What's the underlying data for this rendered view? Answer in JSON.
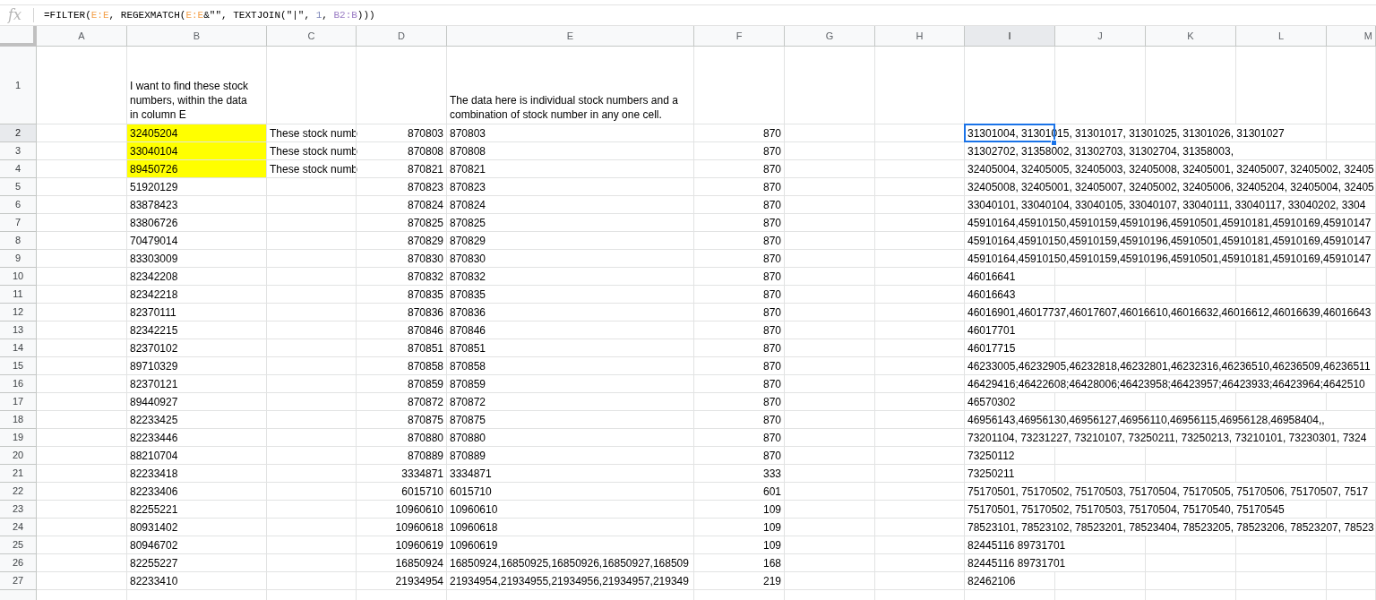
{
  "formula_bar": {
    "function_label": "fx",
    "tokens": [
      {
        "text": "=FILTER(",
        "kind": "plain"
      },
      {
        "text": "E:E",
        "kind": "range",
        "color": "#f4a04a"
      },
      {
        "text": ", REGEXMATCH(",
        "kind": "plain"
      },
      {
        "text": "E:E",
        "kind": "range",
        "color": "#f4a04a"
      },
      {
        "text": "&\"\", TEXTJOIN(\"|\", ",
        "kind": "plain"
      },
      {
        "text": "1",
        "kind": "number"
      },
      {
        "text": ", ",
        "kind": "plain"
      },
      {
        "text": "B2:B",
        "kind": "range",
        "color": "#9a7cc4"
      },
      {
        "text": ")))",
        "kind": "plain"
      }
    ]
  },
  "column_headers": [
    {
      "label": "A",
      "selected": false
    },
    {
      "label": "B",
      "selected": false
    },
    {
      "label": "C",
      "selected": false
    },
    {
      "label": "D",
      "selected": false
    },
    {
      "label": "E",
      "selected": false
    },
    {
      "label": "F",
      "selected": false
    },
    {
      "label": "G",
      "selected": false
    },
    {
      "label": "H",
      "selected": false
    },
    {
      "label": "I",
      "selected": true
    },
    {
      "label": "J",
      "selected": false
    },
    {
      "label": "K",
      "selected": false
    },
    {
      "label": "L",
      "selected": false
    },
    {
      "label": "M",
      "selected": false
    }
  ],
  "rows": [
    {
      "number": "1",
      "kind": "note",
      "selected": false,
      "B": {
        "text": "I want to find these stock numbers, within the data in column E",
        "highlighted": false
      },
      "E": "The data here is individual stock numbers and a combination of stock number in any one cell."
    },
    {
      "number": "2",
      "kind": "data",
      "selected": true,
      "B": {
        "text": "32405204",
        "highlighted": true
      },
      "C": "These stock numb",
      "D": "870803",
      "E": "870803",
      "F": "870",
      "I": "31301004, 31301015, 31301017, 31301025, 31301026, 31301027"
    },
    {
      "number": "3",
      "kind": "data",
      "selected": false,
      "B": {
        "text": "33040104",
        "highlighted": true
      },
      "C": "These stock numb",
      "D": "870808",
      "E": "870808",
      "F": "870",
      "I": "31302702, 31358002, 31302703, 31302704, 31358003,"
    },
    {
      "number": "4",
      "kind": "data",
      "selected": false,
      "B": {
        "text": "89450726",
        "highlighted": true
      },
      "C": "These stock numb",
      "D": "870821",
      "E": "870821",
      "F": "870",
      "I": "32405004, 32405005, 32405003, 32405008, 32405001, 32405007, 32405002, 32405"
    },
    {
      "number": "5",
      "kind": "data",
      "selected": false,
      "B": {
        "text": "51920129",
        "highlighted": false
      },
      "D": "870823",
      "E": "870823",
      "F": "870",
      "I": "32405008, 32405001, 32405007, 32405002, 32405006, 32405204, 32405004, 32405"
    },
    {
      "number": "6",
      "kind": "data",
      "selected": false,
      "B": {
        "text": "83878423",
        "highlighted": false
      },
      "D": "870824",
      "E": "870824",
      "F": "870",
      "I": "33040101, 33040104, 33040105, 33040107, 33040111, 33040117, 33040202, 3304"
    },
    {
      "number": "7",
      "kind": "data",
      "selected": false,
      "B": {
        "text": "83806726",
        "highlighted": false
      },
      "D": "870825",
      "E": "870825",
      "F": "870",
      "I": "45910164,45910150,45910159,45910196,45910501,45910181,45910169,45910147"
    },
    {
      "number": "8",
      "kind": "data",
      "selected": false,
      "B": {
        "text": "70479014",
        "highlighted": false
      },
      "D": "870829",
      "E": "870829",
      "F": "870",
      "I": "45910164,45910150,45910159,45910196,45910501,45910181,45910169,45910147"
    },
    {
      "number": "9",
      "kind": "data",
      "selected": false,
      "B": {
        "text": "83303009",
        "highlighted": false
      },
      "D": "870830",
      "E": "870830",
      "F": "870",
      "I": "45910164,45910150,45910159,45910196,45910501,45910181,45910169,45910147"
    },
    {
      "number": "10",
      "kind": "data",
      "selected": false,
      "B": {
        "text": "82342208",
        "highlighted": false
      },
      "D": "870832",
      "E": "870832",
      "F": "870",
      "I": "46016641"
    },
    {
      "number": "11",
      "kind": "data",
      "selected": false,
      "B": {
        "text": "82342218",
        "highlighted": false
      },
      "D": "870835",
      "E": "870835",
      "F": "870",
      "I": "46016643"
    },
    {
      "number": "12",
      "kind": "data",
      "selected": false,
      "B": {
        "text": "82370111",
        "highlighted": false
      },
      "D": "870836",
      "E": "870836",
      "F": "870",
      "I": "46016901,46017737,46017607,46016610,46016632,46016612,46016639,46016643"
    },
    {
      "number": "13",
      "kind": "data",
      "selected": false,
      "B": {
        "text": "82342215",
        "highlighted": false
      },
      "D": "870846",
      "E": "870846",
      "F": "870",
      "I": "46017701"
    },
    {
      "number": "14",
      "kind": "data",
      "selected": false,
      "B": {
        "text": "82370102",
        "highlighted": false
      },
      "D": "870851",
      "E": "870851",
      "F": "870",
      "I": "46017715"
    },
    {
      "number": "15",
      "kind": "data",
      "selected": false,
      "B": {
        "text": "89710329",
        "highlighted": false
      },
      "D": "870858",
      "E": "870858",
      "F": "870",
      "I": "46233005,46232905,46232818,46232801,46232316,46236510,46236509,46236511"
    },
    {
      "number": "16",
      "kind": "data",
      "selected": false,
      "B": {
        "text": "82370121",
        "highlighted": false
      },
      "D": "870859",
      "E": "870859",
      "F": "870",
      "I": "46429416;46422608;46428006;46423958;46423957;46423933;46423964;4642510"
    },
    {
      "number": "17",
      "kind": "data",
      "selected": false,
      "B": {
        "text": "89440927",
        "highlighted": false
      },
      "D": "870872",
      "E": "870872",
      "F": "870",
      "I": "46570302"
    },
    {
      "number": "18",
      "kind": "data",
      "selected": false,
      "B": {
        "text": "82233425",
        "highlighted": false
      },
      "D": "870875",
      "E": "870875",
      "F": "870",
      "I": "46956143,46956130,46956127,46956110,46956115,46956128,46958404,,"
    },
    {
      "number": "19",
      "kind": "data",
      "selected": false,
      "B": {
        "text": "82233446",
        "highlighted": false
      },
      "D": "870880",
      "E": "870880",
      "F": "870",
      "I": "73201104, 73231227, 73210107, 73250211, 73250213, 73210101, 73230301, 7324"
    },
    {
      "number": "20",
      "kind": "data",
      "selected": false,
      "B": {
        "text": "88210704",
        "highlighted": false
      },
      "D": "870889",
      "E": "870889",
      "F": "870",
      "I": "73250112"
    },
    {
      "number": "21",
      "kind": "data",
      "selected": false,
      "B": {
        "text": "82233418",
        "highlighted": false
      },
      "D": "3334871",
      "E": "3334871",
      "F": "333",
      "I": "73250211"
    },
    {
      "number": "22",
      "kind": "data",
      "selected": false,
      "B": {
        "text": "82233406",
        "highlighted": false
      },
      "D": "6015710",
      "E": "6015710",
      "F": "601",
      "I": "75170501, 75170502, 75170503, 75170504, 75170505, 75170506, 75170507, 7517"
    },
    {
      "number": "23",
      "kind": "data",
      "selected": false,
      "B": {
        "text": "82255221",
        "highlighted": false
      },
      "D": "10960610",
      "E": "10960610",
      "F": "109",
      "I": "75170501, 75170502, 75170503, 75170504, 75170540, 75170545"
    },
    {
      "number": "24",
      "kind": "data",
      "selected": false,
      "B": {
        "text": "80931402",
        "highlighted": false
      },
      "D": "10960618",
      "E": "10960618",
      "F": "109",
      "I": "78523101, 78523102, 78523201, 78523404, 78523205, 78523206, 78523207, 78523"
    },
    {
      "number": "25",
      "kind": "data",
      "selected": false,
      "B": {
        "text": "80946702",
        "highlighted": false
      },
      "D": "10960619",
      "E": "10960619",
      "F": "109",
      "I": "82445116 89731701"
    },
    {
      "number": "26",
      "kind": "data",
      "selected": false,
      "B": {
        "text": "82255227",
        "highlighted": false
      },
      "D": "16850924",
      "E": "16850924,16850925,16850926,16850927,168509",
      "F": "168",
      "I": "82445116 89731701"
    },
    {
      "number": "27",
      "kind": "data",
      "selected": false,
      "B": {
        "text": "82233410",
        "highlighted": false
      },
      "D": "21934954",
      "E": "21934954,21934955,21934956,21934957,219349",
      "F": "219",
      "I": "82462106"
    }
  ]
}
